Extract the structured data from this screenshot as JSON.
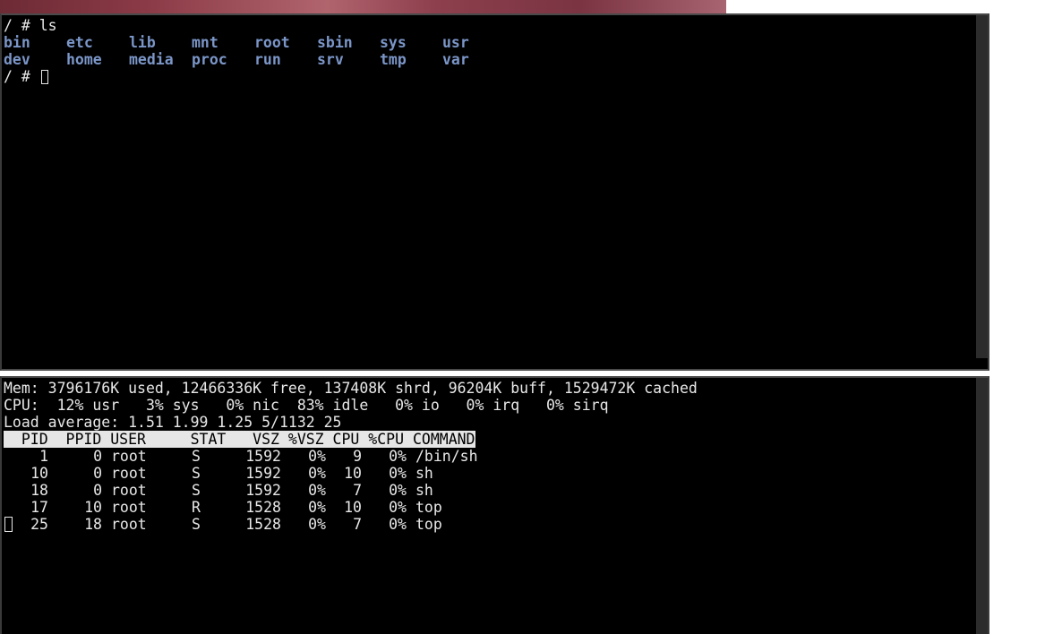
{
  "top_terminal": {
    "command_line": "/ # ls",
    "ls_row1": [
      "bin",
      "etc",
      "lib",
      "mnt",
      "root",
      "sbin",
      "sys",
      "usr"
    ],
    "ls_row2": [
      "dev",
      "home",
      "media",
      "proc",
      "run",
      "srv",
      "tmp",
      "var"
    ],
    "prompt": "/ # "
  },
  "bottom_terminal": {
    "mem_line": "Mem: 3796176K used, 12466336K free, 137408K shrd, 96204K buff, 1529472K cached",
    "cpu_line": "CPU:  12% usr   3% sys   0% nic  83% idle   0% io   0% irq   0% sirq",
    "load_line": "Load average: 1.51 1.99 1.25 5/1132 25",
    "header": "  PID  PPID USER     STAT   VSZ %VSZ CPU %CPU COMMAND",
    "processes": [
      {
        "pid": "1",
        "ppid": "0",
        "user": "root",
        "stat": "S",
        "vsz": "1592",
        "pvsz": "0%",
        "cpu": "9",
        "pcpu": "0%",
        "command": "/bin/sh"
      },
      {
        "pid": "10",
        "ppid": "0",
        "user": "root",
        "stat": "S",
        "vsz": "1592",
        "pvsz": "0%",
        "cpu": "10",
        "pcpu": "0%",
        "command": "sh"
      },
      {
        "pid": "18",
        "ppid": "0",
        "user": "root",
        "stat": "S",
        "vsz": "1592",
        "pvsz": "0%",
        "cpu": "7",
        "pcpu": "0%",
        "command": "sh"
      },
      {
        "pid": "17",
        "ppid": "10",
        "user": "root",
        "stat": "R",
        "vsz": "1528",
        "pvsz": "0%",
        "cpu": "10",
        "pcpu": "0%",
        "command": "top"
      },
      {
        "pid": "25",
        "ppid": "18",
        "user": "root",
        "stat": "S",
        "vsz": "1528",
        "pvsz": "0%",
        "cpu": "7",
        "pcpu": "0%",
        "command": "top"
      }
    ]
  },
  "colors": {
    "terminal_bg": "#000000",
    "terminal_fg": "#e8e8e8",
    "directory": "#7b96c8",
    "header_bg": "#e6e6e6"
  }
}
